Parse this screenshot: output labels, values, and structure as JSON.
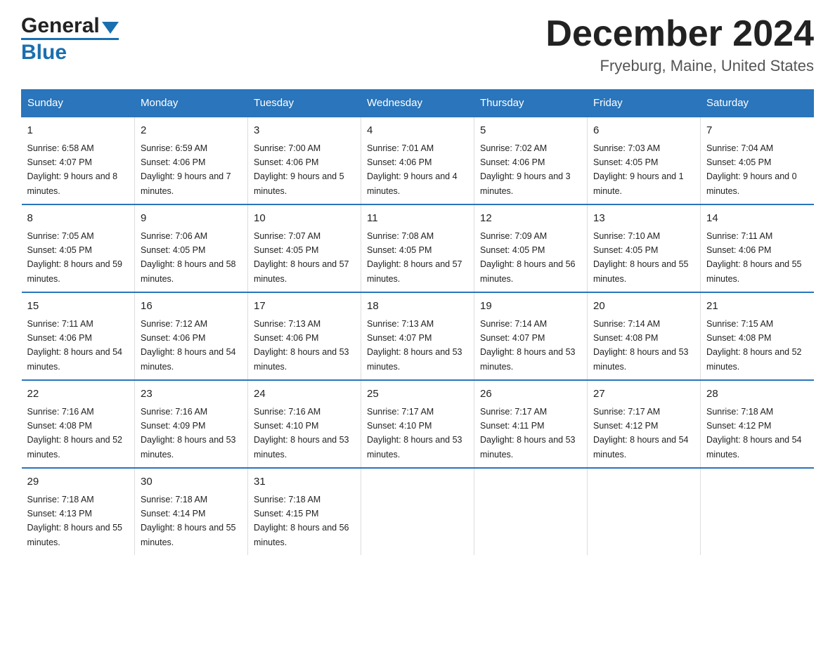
{
  "header": {
    "logo": {
      "general": "General",
      "blue": "Blue"
    },
    "title": "December 2024",
    "subtitle": "Fryeburg, Maine, United States"
  },
  "calendar": {
    "days_of_week": [
      "Sunday",
      "Monday",
      "Tuesday",
      "Wednesday",
      "Thursday",
      "Friday",
      "Saturday"
    ],
    "weeks": [
      [
        {
          "date": "1",
          "sunrise": "6:58 AM",
          "sunset": "4:07 PM",
          "daylight": "9 hours and 8 minutes."
        },
        {
          "date": "2",
          "sunrise": "6:59 AM",
          "sunset": "4:06 PM",
          "daylight": "9 hours and 7 minutes."
        },
        {
          "date": "3",
          "sunrise": "7:00 AM",
          "sunset": "4:06 PM",
          "daylight": "9 hours and 5 minutes."
        },
        {
          "date": "4",
          "sunrise": "7:01 AM",
          "sunset": "4:06 PM",
          "daylight": "9 hours and 4 minutes."
        },
        {
          "date": "5",
          "sunrise": "7:02 AM",
          "sunset": "4:06 PM",
          "daylight": "9 hours and 3 minutes."
        },
        {
          "date": "6",
          "sunrise": "7:03 AM",
          "sunset": "4:05 PM",
          "daylight": "9 hours and 1 minute."
        },
        {
          "date": "7",
          "sunrise": "7:04 AM",
          "sunset": "4:05 PM",
          "daylight": "9 hours and 0 minutes."
        }
      ],
      [
        {
          "date": "8",
          "sunrise": "7:05 AM",
          "sunset": "4:05 PM",
          "daylight": "8 hours and 59 minutes."
        },
        {
          "date": "9",
          "sunrise": "7:06 AM",
          "sunset": "4:05 PM",
          "daylight": "8 hours and 58 minutes."
        },
        {
          "date": "10",
          "sunrise": "7:07 AM",
          "sunset": "4:05 PM",
          "daylight": "8 hours and 57 minutes."
        },
        {
          "date": "11",
          "sunrise": "7:08 AM",
          "sunset": "4:05 PM",
          "daylight": "8 hours and 57 minutes."
        },
        {
          "date": "12",
          "sunrise": "7:09 AM",
          "sunset": "4:05 PM",
          "daylight": "8 hours and 56 minutes."
        },
        {
          "date": "13",
          "sunrise": "7:10 AM",
          "sunset": "4:05 PM",
          "daylight": "8 hours and 55 minutes."
        },
        {
          "date": "14",
          "sunrise": "7:11 AM",
          "sunset": "4:06 PM",
          "daylight": "8 hours and 55 minutes."
        }
      ],
      [
        {
          "date": "15",
          "sunrise": "7:11 AM",
          "sunset": "4:06 PM",
          "daylight": "8 hours and 54 minutes."
        },
        {
          "date": "16",
          "sunrise": "7:12 AM",
          "sunset": "4:06 PM",
          "daylight": "8 hours and 54 minutes."
        },
        {
          "date": "17",
          "sunrise": "7:13 AM",
          "sunset": "4:06 PM",
          "daylight": "8 hours and 53 minutes."
        },
        {
          "date": "18",
          "sunrise": "7:13 AM",
          "sunset": "4:07 PM",
          "daylight": "8 hours and 53 minutes."
        },
        {
          "date": "19",
          "sunrise": "7:14 AM",
          "sunset": "4:07 PM",
          "daylight": "8 hours and 53 minutes."
        },
        {
          "date": "20",
          "sunrise": "7:14 AM",
          "sunset": "4:08 PM",
          "daylight": "8 hours and 53 minutes."
        },
        {
          "date": "21",
          "sunrise": "7:15 AM",
          "sunset": "4:08 PM",
          "daylight": "8 hours and 52 minutes."
        }
      ],
      [
        {
          "date": "22",
          "sunrise": "7:16 AM",
          "sunset": "4:08 PM",
          "daylight": "8 hours and 52 minutes."
        },
        {
          "date": "23",
          "sunrise": "7:16 AM",
          "sunset": "4:09 PM",
          "daylight": "8 hours and 53 minutes."
        },
        {
          "date": "24",
          "sunrise": "7:16 AM",
          "sunset": "4:10 PM",
          "daylight": "8 hours and 53 minutes."
        },
        {
          "date": "25",
          "sunrise": "7:17 AM",
          "sunset": "4:10 PM",
          "daylight": "8 hours and 53 minutes."
        },
        {
          "date": "26",
          "sunrise": "7:17 AM",
          "sunset": "4:11 PM",
          "daylight": "8 hours and 53 minutes."
        },
        {
          "date": "27",
          "sunrise": "7:17 AM",
          "sunset": "4:12 PM",
          "daylight": "8 hours and 54 minutes."
        },
        {
          "date": "28",
          "sunrise": "7:18 AM",
          "sunset": "4:12 PM",
          "daylight": "8 hours and 54 minutes."
        }
      ],
      [
        {
          "date": "29",
          "sunrise": "7:18 AM",
          "sunset": "4:13 PM",
          "daylight": "8 hours and 55 minutes."
        },
        {
          "date": "30",
          "sunrise": "7:18 AM",
          "sunset": "4:14 PM",
          "daylight": "8 hours and 55 minutes."
        },
        {
          "date": "31",
          "sunrise": "7:18 AM",
          "sunset": "4:15 PM",
          "daylight": "8 hours and 56 minutes."
        },
        {
          "date": "",
          "sunrise": "",
          "sunset": "",
          "daylight": ""
        },
        {
          "date": "",
          "sunrise": "",
          "sunset": "",
          "daylight": ""
        },
        {
          "date": "",
          "sunrise": "",
          "sunset": "",
          "daylight": ""
        },
        {
          "date": "",
          "sunrise": "",
          "sunset": "",
          "daylight": ""
        }
      ]
    ]
  }
}
